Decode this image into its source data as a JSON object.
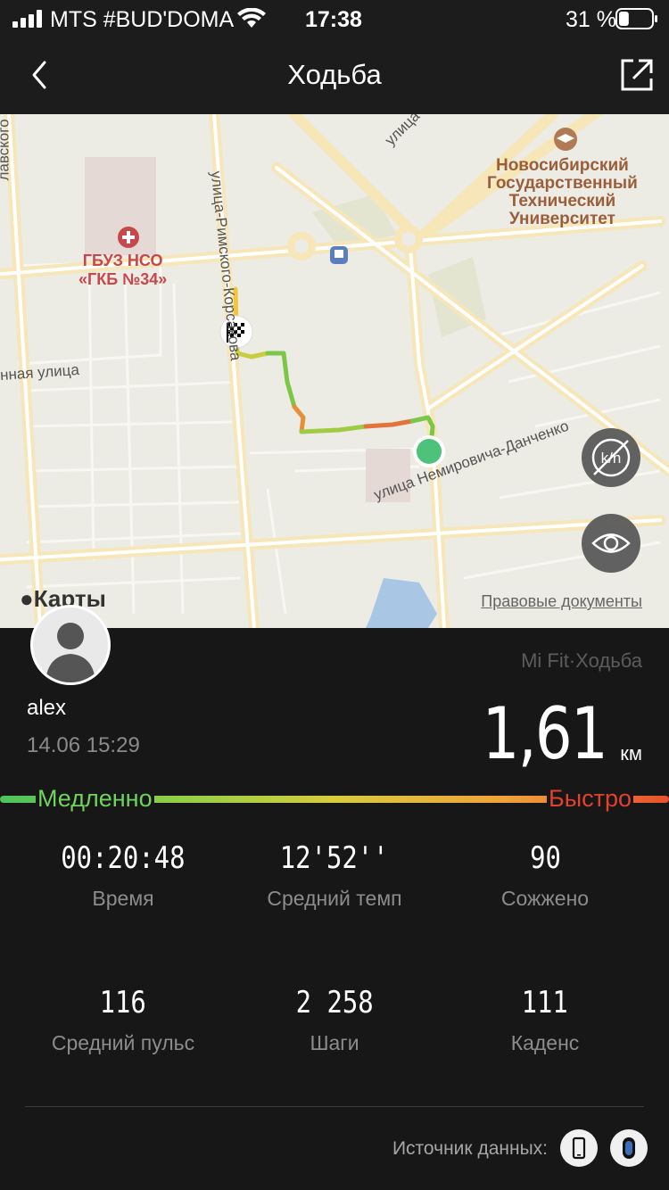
{
  "status_bar": {
    "carrier": "MTS #BUD'DOMA",
    "time": "17:38",
    "battery_percent": "31 %",
    "battery_level": 0.31
  },
  "nav": {
    "title": "Ходьба"
  },
  "map": {
    "street_labels": {
      "top_left": "лавского",
      "street_north": "улица",
      "rimsky": "улица-Римского-Корсакова",
      "left_street": "нная улица",
      "nemirovich": "улица Немировича-Данченко"
    },
    "poi_university": [
      "Новосибирский",
      "Государственный",
      "Технический",
      "Университет"
    ],
    "poi_hospital": [
      "ГБУЗ НСО",
      "«ГКБ №34»"
    ],
    "brand": "Карты",
    "legal": "Правовые документы",
    "colors": {
      "finish_marker": "#ffffff",
      "start_marker": "#4dc27a"
    }
  },
  "workout": {
    "user_name": "alex",
    "datetime": "14.06 15:29",
    "source": "Mi Fit·Ходьба",
    "distance": "1,61",
    "distance_unit": "км",
    "pace_slow": "Медленно",
    "pace_fast": "Быстро"
  },
  "stats": [
    {
      "value": "00:20:48",
      "label": "Время"
    },
    {
      "value": "12'52''",
      "label": "Средний темп"
    },
    {
      "value": "90",
      "label": "Сожжено"
    },
    {
      "value": "116",
      "label": "Средний пульс"
    },
    {
      "value": "2 258",
      "label": "Шаги"
    },
    {
      "value": "111",
      "label": "Каденс"
    }
  ],
  "footer": {
    "data_source_label": "Источник данных:"
  }
}
